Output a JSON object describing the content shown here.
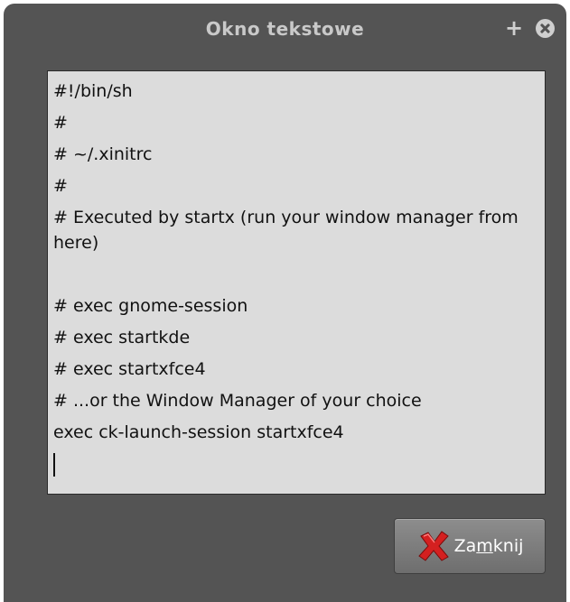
{
  "window": {
    "title": "Okno tekstowe",
    "maximize_glyph": "+",
    "close_icon": "close-circle-icon"
  },
  "text_area": {
    "lines": [
      "#!/bin/sh",
      "#",
      "# ~/.xinitrc",
      "#",
      "# Executed by startx (run your window manager from here)",
      "",
      "# exec gnome-session",
      "# exec startkde",
      "# exec startxfce4",
      "# ...or the Window Manager of your choice",
      "exec ck-launch-session startxfce4"
    ]
  },
  "close_button": {
    "label_before": "Za",
    "label_mnemonic": "m",
    "label_after": "knij",
    "icon": "red-x-icon"
  },
  "colors": {
    "window_bg": "#545454",
    "text_area_bg": "#dcdcdc",
    "title_text": "#c9c9c9",
    "close_icon_red": "#d42020"
  }
}
